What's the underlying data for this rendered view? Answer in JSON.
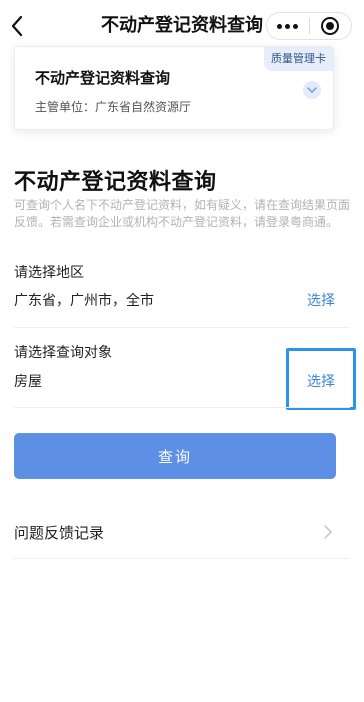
{
  "navbar": {
    "title": "不动产登记资料查询",
    "icons": {
      "back": "back-arrow-icon",
      "more": "more-dots-icon",
      "close": "close-target-icon"
    }
  },
  "card": {
    "badge": "质量管理卡",
    "title": "不动产登记资料查询",
    "subtitle": "主管单位：广东省自然资源厅",
    "chevron_icon": "chevron-down-icon"
  },
  "main": {
    "heading": "不动产登记资料查询",
    "description": "可查询个人名下不动产登记资料，如有疑义，请在查询结果页面反馈。若需查询企业或机构不动产登记资料，请登录粤商通。",
    "region": {
      "label": "请选择地区",
      "value": "广东省，广州市，全市",
      "action": "选择"
    },
    "target": {
      "label": "请选择查询对象",
      "value": "房屋",
      "action": "选择"
    },
    "query_button": "查询",
    "feedback": {
      "label": "问题反馈记录",
      "icon": "chevron-right-icon"
    }
  },
  "colors": {
    "accent": "#3d86d8",
    "button": "#5d8fe4",
    "highlight": "#2b95e6",
    "badge_bg": "#e6eefb"
  }
}
